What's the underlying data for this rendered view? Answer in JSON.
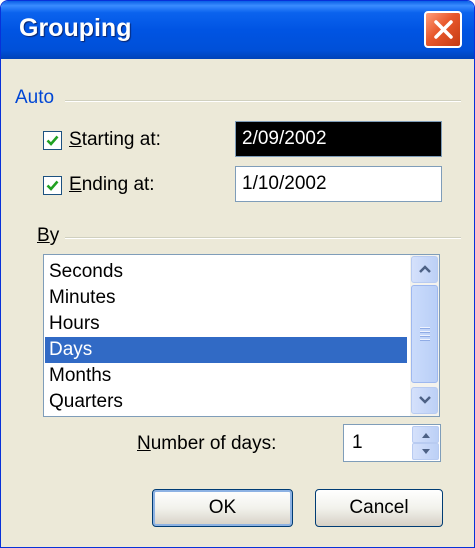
{
  "window": {
    "title": "Grouping"
  },
  "auto": {
    "label": "Auto",
    "starting": {
      "label_mnemonic": "S",
      "label_rest": "tarting at:",
      "checked": true,
      "value": "2/09/2002"
    },
    "ending": {
      "label_mnemonic": "E",
      "label_rest": "nding at:",
      "checked": true,
      "value": "1/10/2002"
    }
  },
  "by": {
    "label_mnemonic": "B",
    "label_rest": "y",
    "items": [
      "Seconds",
      "Minutes",
      "Hours",
      "Days",
      "Months",
      "Quarters"
    ],
    "selected": "Days"
  },
  "number_of_days": {
    "label_mnemonic": "N",
    "label_rest": "umber of days:",
    "value": "1"
  },
  "buttons": {
    "ok": "OK",
    "cancel": "Cancel"
  },
  "icons": {
    "close": "close-icon",
    "check": "checkmark-icon",
    "scroll_up": "arrow-up-icon",
    "scroll_down": "arrow-down-icon",
    "spin_up": "spin-up-icon",
    "spin_down": "spin-down-icon"
  },
  "colors": {
    "titlebar": "#0054e3",
    "group_label": "#0046d5",
    "selection": "#316ac5",
    "dialog_bg": "#ece9d8"
  }
}
